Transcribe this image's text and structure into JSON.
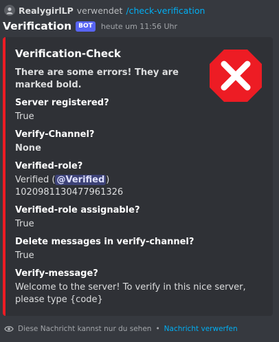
{
  "reply": {
    "username": "RealygirlLP",
    "verb": "verwendet",
    "command": "/check-verification"
  },
  "message": {
    "bot_name": "Verification",
    "bot_tag": "BOT",
    "timestamp": "heute um 11:56 Uhr"
  },
  "embed": {
    "accent_color": "#ed1c24",
    "title": "Verification-Check",
    "description": "There are some errors! They are marked bold.",
    "thumbnail_icon": "red-x-error-icon",
    "fields": [
      {
        "name": "Server registered?",
        "value": "True"
      },
      {
        "name": "Verify-Channel?",
        "value": "None"
      },
      {
        "name": "Verified-role?",
        "value_prefix": "Verified (",
        "mention": "@Verified",
        "value_suffix": ")",
        "value_line2": "1020981130477961326"
      },
      {
        "name": "Verified-role assignable?",
        "value": "True"
      },
      {
        "name": "Delete messages in verify-channel?",
        "value": "True"
      },
      {
        "name": "Verify-message?",
        "value": "Welcome to the server! To verify in this nice server, please type {code}"
      }
    ]
  },
  "footer": {
    "ephemeral_note": "Diese Nachricht kannst nur du sehen",
    "separator": "•",
    "dismiss_label": "Nachricht verwerfen"
  }
}
